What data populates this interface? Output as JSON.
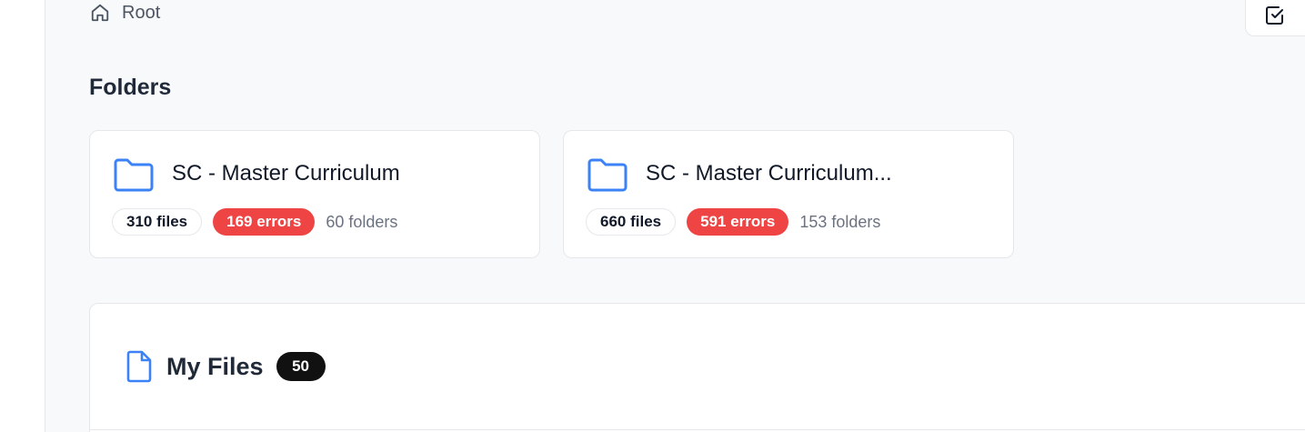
{
  "breadcrumb": {
    "home_icon": "home-icon",
    "current": "Root"
  },
  "toolbar": {
    "select_icon": "check-square-icon"
  },
  "folders_section": {
    "title": "Folders",
    "items": [
      {
        "icon": "folder-icon",
        "name": "SC - Master Curriculum",
        "files": "310 files",
        "errors": "169 errors",
        "folders": "60 folders"
      },
      {
        "icon": "folder-icon",
        "name": "SC - Master Curriculum...",
        "files": "660 files",
        "errors": "591 errors",
        "folders": "153 folders"
      }
    ]
  },
  "files_section": {
    "icon": "file-icon",
    "title": "My Files",
    "count": "50"
  },
  "colors": {
    "accent": "#3b82f6",
    "error": "#ef4444",
    "badge_dark": "#111111",
    "background": "#f8f9fb"
  }
}
